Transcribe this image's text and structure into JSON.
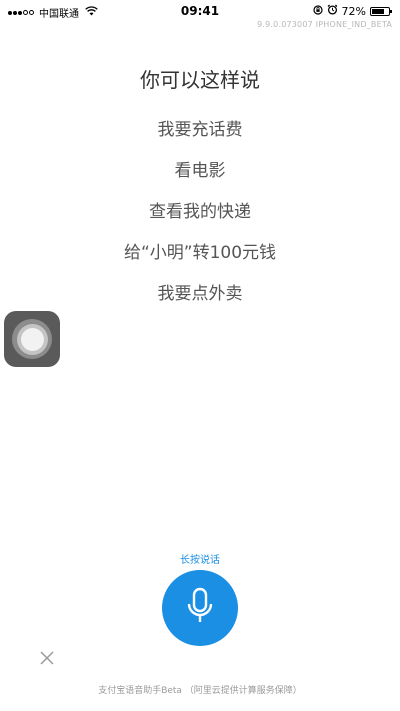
{
  "status_bar": {
    "carrier": "中国联通",
    "time": "09:41",
    "battery_percent": "72%",
    "battery_level": 0.72,
    "version": "9.9.0.073007 IPHONE_IND_BETA"
  },
  "main": {
    "title": "你可以这样说",
    "suggestions": [
      "我要充话费",
      "看电影",
      "查看我的快递",
      "给“小明”转100元钱",
      "我要点外卖"
    ]
  },
  "voice": {
    "hint": "长按说话"
  },
  "footer": {
    "text": "支付宝语音助手Beta （阿里云提供计算服务保障）"
  },
  "icons": {
    "mic": "microphone-icon",
    "close": "close-icon",
    "assistive": "assistive-touch-icon",
    "wifi": "wifi-icon",
    "alarm": "alarm-icon",
    "lock": "rotation-lock-icon",
    "battery": "battery-icon"
  },
  "colors": {
    "accent": "#1a8fe3",
    "text_primary": "#333333",
    "text_secondary": "#555555",
    "footer_text": "#9a9a9a"
  }
}
